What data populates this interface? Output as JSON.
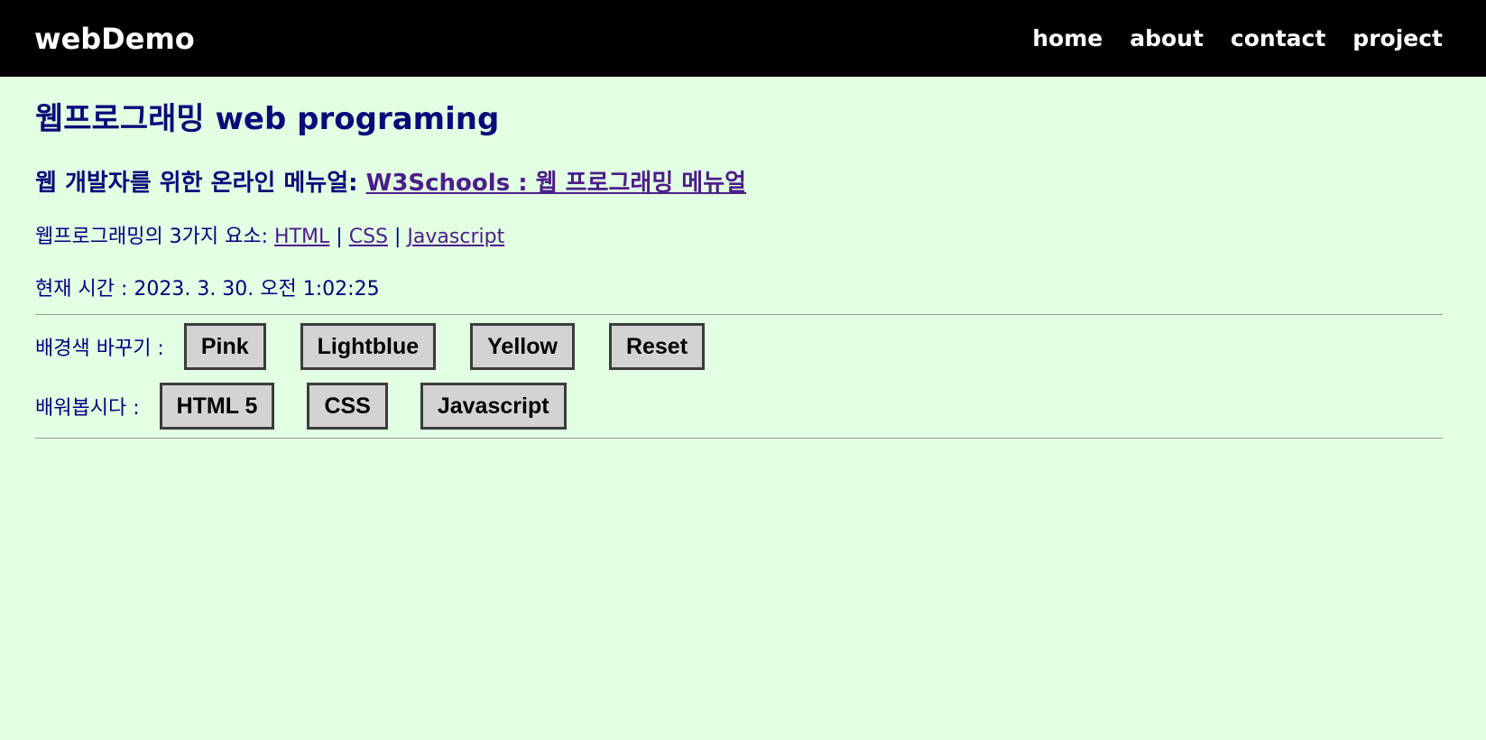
{
  "header": {
    "brand": "webDemo",
    "nav": [
      "home",
      "about",
      "contact",
      "project"
    ]
  },
  "main": {
    "title": "웹프로그래밍 web programing",
    "subtitle_prefix": "웹 개발자를 위한 온라인 메뉴얼:",
    "subtitle_link": "W3Schools : 웹 프로그래밍 메뉴얼",
    "elements_prefix": "웹프로그래밍의 3가지 요소:",
    "elements_links": [
      "HTML",
      "CSS",
      "Javascript"
    ],
    "separator": "|",
    "clock_label": "현재 시간 : 2023. 3. 30. 오전 1:02:25"
  },
  "bg_controls": {
    "label": "배경색 바꾸기 :",
    "buttons": [
      "Pink",
      "Lightblue",
      "Yellow",
      "Reset"
    ]
  },
  "learn": {
    "label": "배워봅시다 :",
    "buttons": [
      "HTML 5",
      "CSS",
      "Javascript"
    ]
  },
  "colors": {
    "page_background": "#e3ffe3",
    "header_background": "#000000",
    "text": "#000080",
    "link": "#4b1e8a",
    "button_background": "#d3d3d3"
  }
}
